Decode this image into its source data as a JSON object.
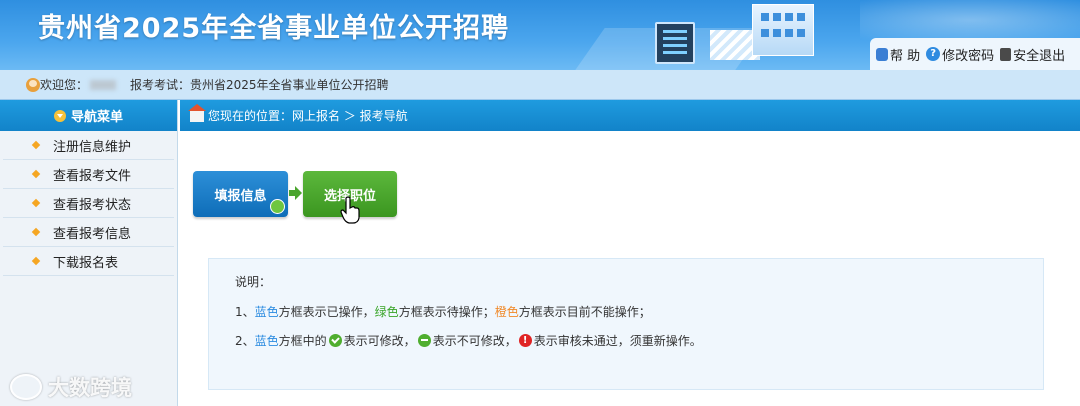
{
  "header": {
    "title": "贵州省2025年全省事业单位公开招聘",
    "links": [
      {
        "icon": "lock-icon",
        "label": "帮 助"
      },
      {
        "icon": "help-icon",
        "label": "修改密码"
      },
      {
        "icon": "exit-icon",
        "label": "安全退出"
      }
    ]
  },
  "userbar": {
    "welcome": "欢迎您：",
    "exam": "报考考试：贵州省2025年全省事业单位公开招聘"
  },
  "sidebar": {
    "title": "导航菜单",
    "items": [
      {
        "label": "注册信息维护"
      },
      {
        "label": "查看报考文件"
      },
      {
        "label": "查看报考状态"
      },
      {
        "label": "查看报考信息"
      },
      {
        "label": "下载报名表"
      }
    ]
  },
  "breadcrumb": {
    "text": "您现在的位置：网上报名 ＞ 报考导航"
  },
  "steps": {
    "step1": "填报信息",
    "step2": "选择职位"
  },
  "note": {
    "title": "说明：",
    "line1": {
      "prefix": "1、",
      "blue": "蓝色",
      "t1": "方框表示已操作，",
      "green": "绿色",
      "t2": "方框表示待操作；",
      "orange": "橙色",
      "t3": "方框表示目前不能操作；"
    },
    "line2": {
      "prefix": "2、",
      "blue": "蓝色",
      "t1": "方框中的",
      "t2": "表示可修改，",
      "t3": "表示不可修改，",
      "t4": "表示审核未通过，须重新操作。"
    }
  },
  "watermark": "大数跨境",
  "colors": {
    "header": "#3a9ae6",
    "nav": "#1283c9",
    "step_done": "#0e6db8",
    "step_pending": "#3b9620",
    "blue_text": "#2c8ce0",
    "green_text": "#3aa529",
    "orange_text": "#f08a2a"
  }
}
